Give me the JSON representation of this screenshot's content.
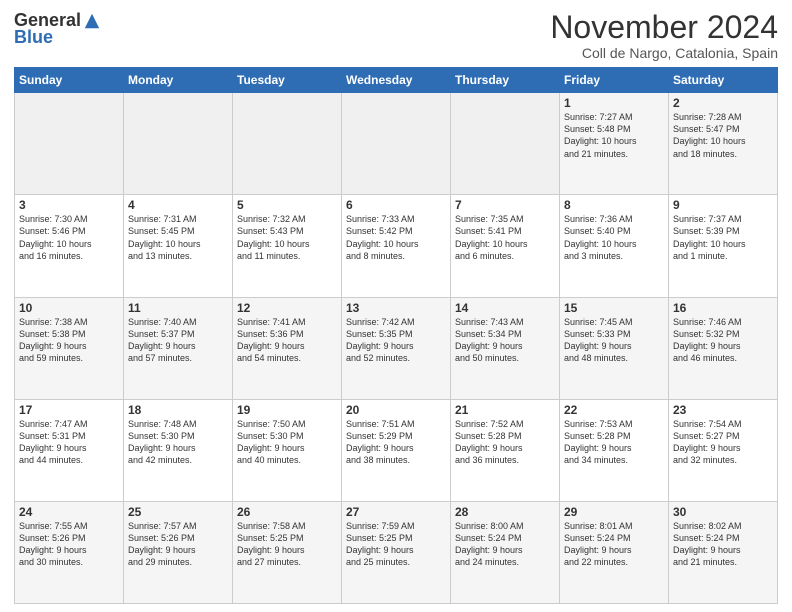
{
  "header": {
    "logo_general": "General",
    "logo_blue": "Blue",
    "month_title": "November 2024",
    "location": "Coll de Nargo, Catalonia, Spain"
  },
  "weekdays": [
    "Sunday",
    "Monday",
    "Tuesday",
    "Wednesday",
    "Thursday",
    "Friday",
    "Saturday"
  ],
  "weeks": [
    [
      {
        "day": "",
        "info": ""
      },
      {
        "day": "",
        "info": ""
      },
      {
        "day": "",
        "info": ""
      },
      {
        "day": "",
        "info": ""
      },
      {
        "day": "",
        "info": ""
      },
      {
        "day": "1",
        "info": "Sunrise: 7:27 AM\nSunset: 5:48 PM\nDaylight: 10 hours\nand 21 minutes."
      },
      {
        "day": "2",
        "info": "Sunrise: 7:28 AM\nSunset: 5:47 PM\nDaylight: 10 hours\nand 18 minutes."
      }
    ],
    [
      {
        "day": "3",
        "info": "Sunrise: 7:30 AM\nSunset: 5:46 PM\nDaylight: 10 hours\nand 16 minutes."
      },
      {
        "day": "4",
        "info": "Sunrise: 7:31 AM\nSunset: 5:45 PM\nDaylight: 10 hours\nand 13 minutes."
      },
      {
        "day": "5",
        "info": "Sunrise: 7:32 AM\nSunset: 5:43 PM\nDaylight: 10 hours\nand 11 minutes."
      },
      {
        "day": "6",
        "info": "Sunrise: 7:33 AM\nSunset: 5:42 PM\nDaylight: 10 hours\nand 8 minutes."
      },
      {
        "day": "7",
        "info": "Sunrise: 7:35 AM\nSunset: 5:41 PM\nDaylight: 10 hours\nand 6 minutes."
      },
      {
        "day": "8",
        "info": "Sunrise: 7:36 AM\nSunset: 5:40 PM\nDaylight: 10 hours\nand 3 minutes."
      },
      {
        "day": "9",
        "info": "Sunrise: 7:37 AM\nSunset: 5:39 PM\nDaylight: 10 hours\nand 1 minute."
      }
    ],
    [
      {
        "day": "10",
        "info": "Sunrise: 7:38 AM\nSunset: 5:38 PM\nDaylight: 9 hours\nand 59 minutes."
      },
      {
        "day": "11",
        "info": "Sunrise: 7:40 AM\nSunset: 5:37 PM\nDaylight: 9 hours\nand 57 minutes."
      },
      {
        "day": "12",
        "info": "Sunrise: 7:41 AM\nSunset: 5:36 PM\nDaylight: 9 hours\nand 54 minutes."
      },
      {
        "day": "13",
        "info": "Sunrise: 7:42 AM\nSunset: 5:35 PM\nDaylight: 9 hours\nand 52 minutes."
      },
      {
        "day": "14",
        "info": "Sunrise: 7:43 AM\nSunset: 5:34 PM\nDaylight: 9 hours\nand 50 minutes."
      },
      {
        "day": "15",
        "info": "Sunrise: 7:45 AM\nSunset: 5:33 PM\nDaylight: 9 hours\nand 48 minutes."
      },
      {
        "day": "16",
        "info": "Sunrise: 7:46 AM\nSunset: 5:32 PM\nDaylight: 9 hours\nand 46 minutes."
      }
    ],
    [
      {
        "day": "17",
        "info": "Sunrise: 7:47 AM\nSunset: 5:31 PM\nDaylight: 9 hours\nand 44 minutes."
      },
      {
        "day": "18",
        "info": "Sunrise: 7:48 AM\nSunset: 5:30 PM\nDaylight: 9 hours\nand 42 minutes."
      },
      {
        "day": "19",
        "info": "Sunrise: 7:50 AM\nSunset: 5:30 PM\nDaylight: 9 hours\nand 40 minutes."
      },
      {
        "day": "20",
        "info": "Sunrise: 7:51 AM\nSunset: 5:29 PM\nDaylight: 9 hours\nand 38 minutes."
      },
      {
        "day": "21",
        "info": "Sunrise: 7:52 AM\nSunset: 5:28 PM\nDaylight: 9 hours\nand 36 minutes."
      },
      {
        "day": "22",
        "info": "Sunrise: 7:53 AM\nSunset: 5:28 PM\nDaylight: 9 hours\nand 34 minutes."
      },
      {
        "day": "23",
        "info": "Sunrise: 7:54 AM\nSunset: 5:27 PM\nDaylight: 9 hours\nand 32 minutes."
      }
    ],
    [
      {
        "day": "24",
        "info": "Sunrise: 7:55 AM\nSunset: 5:26 PM\nDaylight: 9 hours\nand 30 minutes."
      },
      {
        "day": "25",
        "info": "Sunrise: 7:57 AM\nSunset: 5:26 PM\nDaylight: 9 hours\nand 29 minutes."
      },
      {
        "day": "26",
        "info": "Sunrise: 7:58 AM\nSunset: 5:25 PM\nDaylight: 9 hours\nand 27 minutes."
      },
      {
        "day": "27",
        "info": "Sunrise: 7:59 AM\nSunset: 5:25 PM\nDaylight: 9 hours\nand 25 minutes."
      },
      {
        "day": "28",
        "info": "Sunrise: 8:00 AM\nSunset: 5:24 PM\nDaylight: 9 hours\nand 24 minutes."
      },
      {
        "day": "29",
        "info": "Sunrise: 8:01 AM\nSunset: 5:24 PM\nDaylight: 9 hours\nand 22 minutes."
      },
      {
        "day": "30",
        "info": "Sunrise: 8:02 AM\nSunset: 5:24 PM\nDaylight: 9 hours\nand 21 minutes."
      }
    ]
  ]
}
